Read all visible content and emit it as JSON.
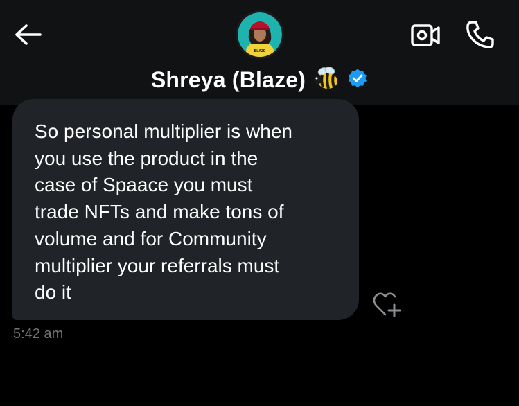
{
  "header": {
    "back_icon": "arrow-left-icon",
    "contact_name": "Shreya (Blaze)",
    "emoji": "🐝",
    "verified_icon": "verified-badge-icon",
    "avatar_caption": "BLAZE",
    "video_icon": "video-camera-icon",
    "call_icon": "phone-icon"
  },
  "conversation": {
    "messages": [
      {
        "text": "So personal multiplier is when\nyou use the product in the\ncase of Spaace you must\ntrade NFTs and make tons of\nvolume and for Community\nmultiplier your referrals must\ndo it",
        "time": "5:42 am",
        "react_icon": "heart-add-icon"
      }
    ]
  },
  "colors": {
    "header_bg": "#111214",
    "bubble_bg": "#202327",
    "verified_blue": "#1d9bf0",
    "timestamp_gray": "#71767b"
  }
}
